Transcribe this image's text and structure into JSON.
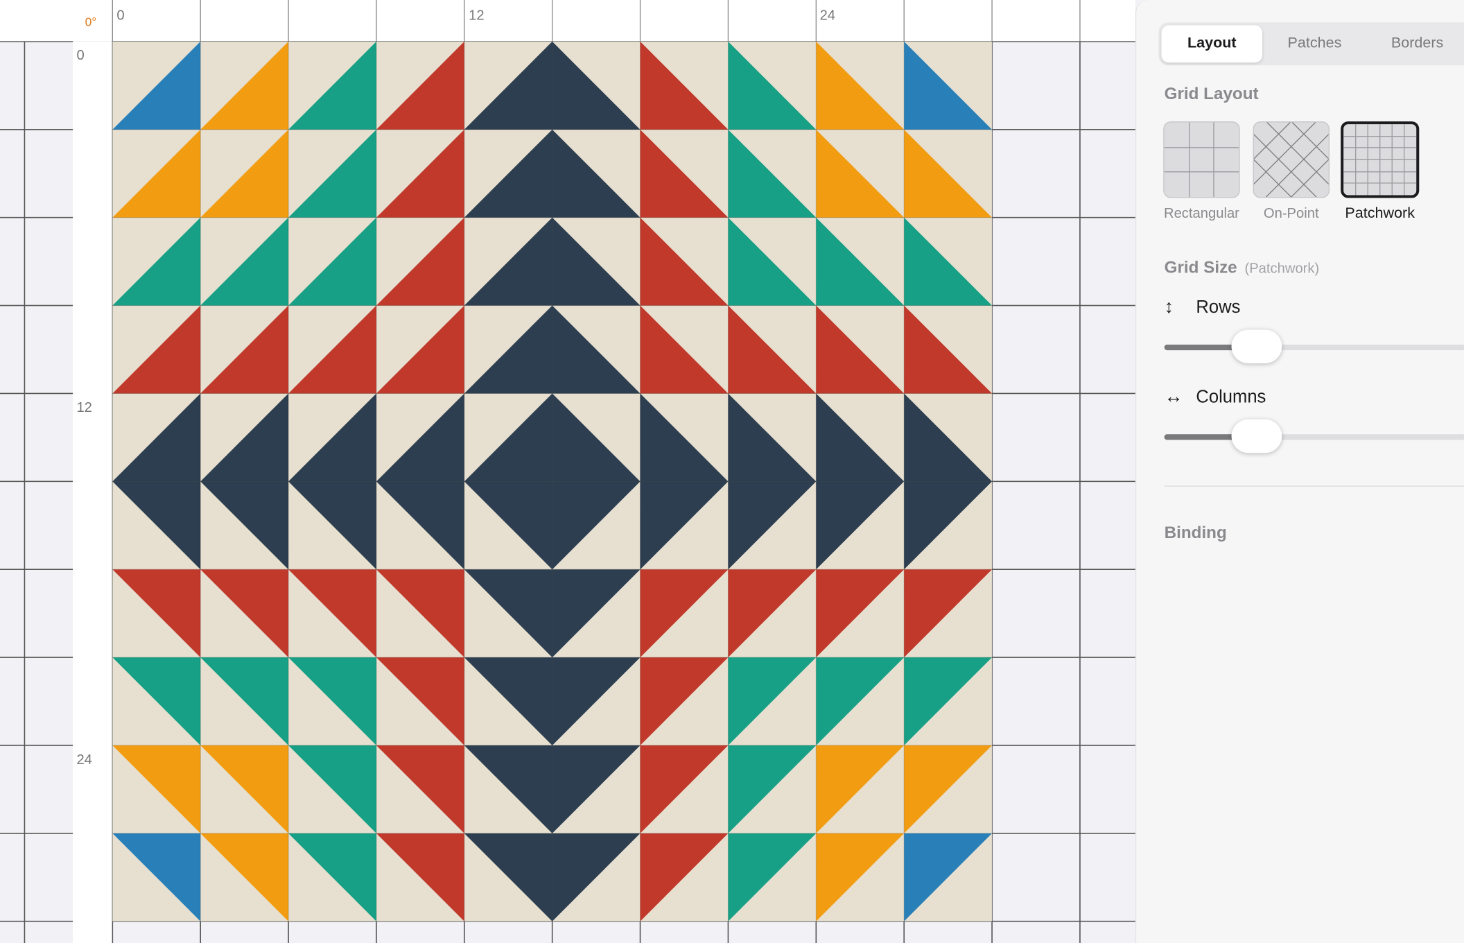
{
  "ruler": {
    "angle": "0°",
    "top_labels": [
      "0",
      "12",
      "24"
    ],
    "left_labels": [
      "0",
      "12",
      "24"
    ]
  },
  "quilt": {
    "rows": 10,
    "columns": 10,
    "colors": {
      "background": "#e7e0d0",
      "navy": "#2d3e50",
      "red": "#c0392b",
      "teal": "#17a085",
      "orange": "#f29c12",
      "blue": "#2980b9"
    }
  },
  "panel": {
    "tabs": [
      {
        "label": "Layout",
        "active": true
      },
      {
        "label": "Patches",
        "active": false
      },
      {
        "label": "Borders",
        "active": false
      }
    ],
    "grid_layout": {
      "title": "Grid Layout",
      "options": [
        {
          "label": "Rectangular",
          "selected": false,
          "icon": "rectangular-grid-icon"
        },
        {
          "label": "On-Point",
          "selected": false,
          "icon": "on-point-grid-icon"
        },
        {
          "label": "Patchwork",
          "selected": true,
          "icon": "patchwork-grid-icon"
        }
      ]
    },
    "grid_size": {
      "title": "Grid Size",
      "subtitle": "(Patchwork)",
      "rows_label": "Rows",
      "rows_icon": "vertical-arrows-icon",
      "rows_value_fraction": 0.29,
      "columns_label": "Columns",
      "columns_icon": "horizontal-arrows-icon",
      "columns_value_fraction": 0.29
    },
    "binding": {
      "title": "Binding"
    }
  }
}
